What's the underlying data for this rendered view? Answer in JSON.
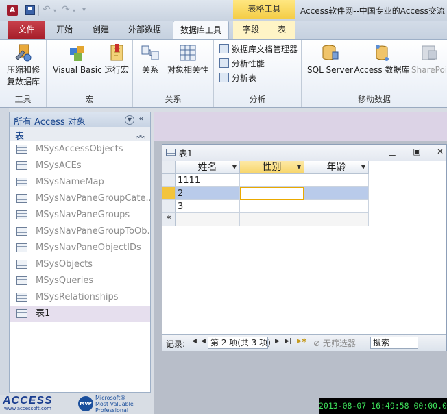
{
  "titlebar": {
    "app_icon": "A",
    "context_tab_header": "表格工具",
    "window_title": "Access软件网--中国专业的Access交流"
  },
  "tabs": [
    {
      "label": "文件"
    },
    {
      "label": "开始"
    },
    {
      "label": "创建"
    },
    {
      "label": "外部数据"
    },
    {
      "label": "数据库工具"
    },
    {
      "label": "字段"
    },
    {
      "label": "表"
    }
  ],
  "ribbon": {
    "groups": {
      "tools": "工具",
      "macro": "宏",
      "relationships": "关系",
      "analyze": "分析",
      "move_data": "移动数据"
    },
    "buttons": {
      "compact_line1": "压缩和修",
      "compact_line2": "复数据库",
      "vba": "Visual Basic",
      "run_macro": "运行宏",
      "relationships": "关系",
      "dependencies": "对象相关性",
      "documenter": "数据库文档管理器",
      "analyze_perf": "分析性能",
      "analyze_table": "分析表",
      "sql_server": "SQL Server",
      "access_db": "Access 数据库",
      "sharepoint": "SharePoi"
    }
  },
  "navpane": {
    "title": "所有 Access 对象",
    "group": "表",
    "items": [
      {
        "label": "MSysAccessObjects"
      },
      {
        "label": "MSysACEs"
      },
      {
        "label": "MSysNameMap"
      },
      {
        "label": "MSysNavPaneGroupCate..."
      },
      {
        "label": "MSysNavPaneGroups"
      },
      {
        "label": "MSysNavPaneGroupToOb..."
      },
      {
        "label": "MSysNavPaneObjectIDs"
      },
      {
        "label": "MSysObjects"
      },
      {
        "label": "MSysQueries"
      },
      {
        "label": "MSysRelationships"
      },
      {
        "label": "表1"
      }
    ]
  },
  "table_window": {
    "title": "表1",
    "columns": [
      "姓名",
      "性别",
      "年龄"
    ],
    "rows": [
      [
        "1111",
        "",
        ""
      ],
      [
        "2",
        "",
        ""
      ],
      [
        "3",
        "",
        ""
      ]
    ],
    "new_row_marker": "*",
    "record_nav": {
      "label": "记录:",
      "position": "第 2 项(共 3 项)",
      "filter": "无筛选器",
      "search": "搜索"
    }
  },
  "footer": {
    "access_logo": "ACCESS",
    "access_url": "www.accessoft.com",
    "mvp_badge": "MVP",
    "mvp_line1": "Microsoft®",
    "mvp_line2": "Most Valuable",
    "mvp_line3": "Professional",
    "timestamp": "2013-08-07 16:49:58 00:00.000"
  }
}
